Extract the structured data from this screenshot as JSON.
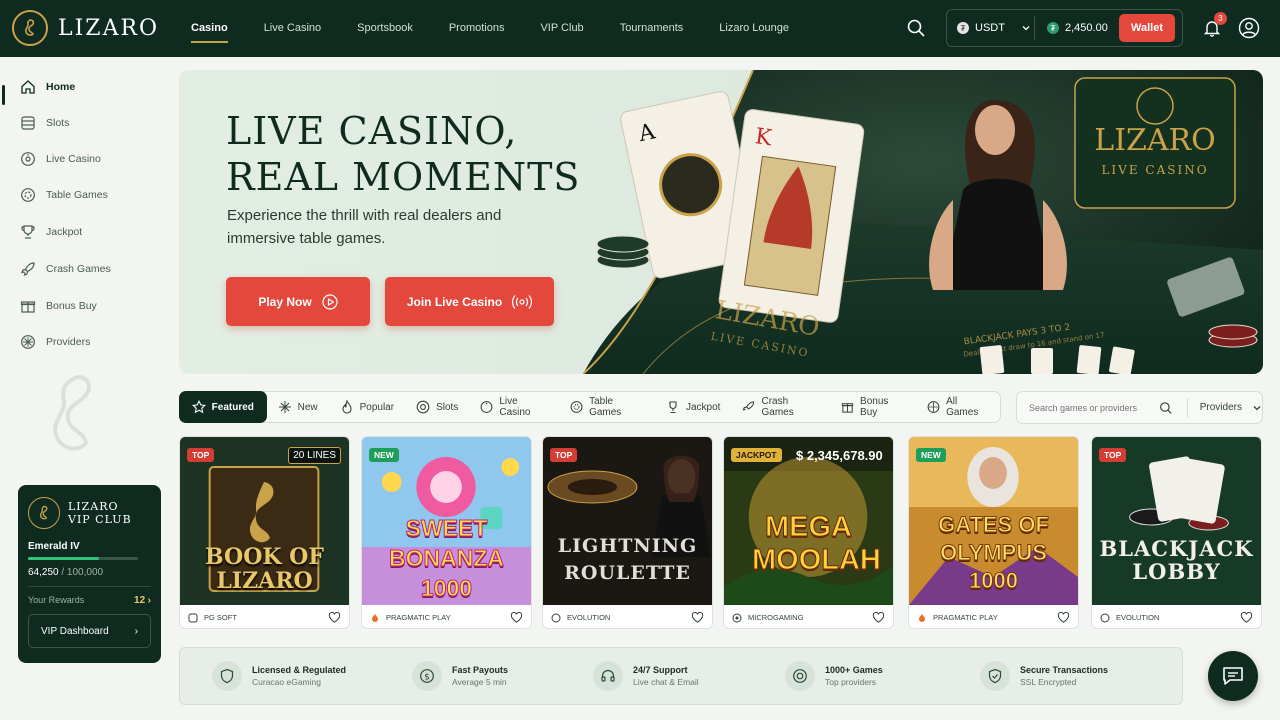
{
  "brand": {
    "name": "LIZARO"
  },
  "nav": {
    "items": [
      "Casino",
      "Live Casino",
      "Sportsbook",
      "Promotions",
      "VIP Club",
      "Tournaments",
      "Lizaro Lounge"
    ],
    "active": "Casino"
  },
  "header": {
    "currency": "USDT",
    "balance": "2,450.00",
    "wallet_label": "Wallet",
    "notification_count": "3",
    "icons": [
      "search-icon",
      "bell-icon",
      "user-icon"
    ]
  },
  "sidebar": {
    "items": [
      {
        "label": "Home",
        "icon": "home-icon",
        "active": true
      },
      {
        "label": "Slots",
        "icon": "slot-machine-icon"
      },
      {
        "label": "Live Casino",
        "icon": "roulette-icon"
      },
      {
        "label": "Table Games",
        "icon": "chip-icon"
      },
      {
        "label": "Jackpot",
        "icon": "trophy-icon"
      },
      {
        "label": "Crash Games",
        "icon": "rocket-icon"
      },
      {
        "label": "Bonus Buy",
        "icon": "gift-icon"
      },
      {
        "label": "Providers",
        "icon": "providers-icon"
      }
    ]
  },
  "vip": {
    "title_line1": "LIZARO",
    "title_line2": "VIP CLUB",
    "level": "Emerald IV",
    "points": "64,250",
    "points_total": "/ 100,000",
    "progress_fraction": 0.6425,
    "rewards_label": "Your Rewards",
    "rewards_count": "12",
    "dashboard_label": "VIP Dashboard"
  },
  "hero": {
    "title_line1": "LIVE CASINO,",
    "title_line2": "REAL MOMENTS",
    "subtitle": "Experience the thrill with real dealers and immersive table games.",
    "play_label": "Play Now",
    "join_label": "Join Live Casino",
    "table_brand": "LIZARO",
    "table_brand_sub": "LIVE CASINO",
    "sign_brand": "LIZARO",
    "sign_sub": "LIVE CASINO",
    "table_text": "BLACKJACK PAYS 3 TO 2",
    "table_text2": "Dealer must draw to 16 and stand on 17"
  },
  "filters": {
    "items": [
      {
        "label": "Featured",
        "icon": "star-icon",
        "active": true
      },
      {
        "label": "New",
        "icon": "sparkle-icon"
      },
      {
        "label": "Popular",
        "icon": "flame-icon"
      },
      {
        "label": "Slots",
        "icon": "slot-icon"
      },
      {
        "label": "Live Casino",
        "icon": "roulette-icon"
      },
      {
        "label": "Table Games",
        "icon": "chip-icon"
      },
      {
        "label": "Jackpot",
        "icon": "trophy-icon"
      },
      {
        "label": "Crash Games",
        "icon": "rocket-icon"
      },
      {
        "label": "Bonus Buy",
        "icon": "gift-icon"
      },
      {
        "label": "All Games",
        "icon": "grid-icon"
      }
    ],
    "search_placeholder": "Search games or providers",
    "providers_label": "Providers"
  },
  "games": [
    {
      "tag": "TOP",
      "tag_type": "top",
      "extra": "20 LINES",
      "title": "BOOK OF LIZARO",
      "provider": "PG SOFT"
    },
    {
      "tag": "NEW",
      "tag_type": "new",
      "title": "SWEET BONANZA 1000",
      "provider": "PRAGMATIC PLAY"
    },
    {
      "tag": "TOP",
      "tag_type": "top",
      "title": "LIGHTNING ROULETTE",
      "provider": "EVOLUTION"
    },
    {
      "tag": "JACKPOT",
      "tag_type": "jackpot",
      "extra": "$ 2,345,678.90",
      "title": "MEGA MOOLAH",
      "provider": "MICROGAMING"
    },
    {
      "tag": "NEW",
      "tag_type": "new",
      "title": "GATES OF OLYMPUS 1000",
      "provider": "PRAGMATIC PLAY"
    },
    {
      "tag": "TOP",
      "tag_type": "top",
      "title": "BLACKJACK LOBBY",
      "provider": "EVOLUTION"
    }
  ],
  "trust": [
    {
      "title": "Licensed & Regulated",
      "sub": "Curacao eGaming",
      "icon": "shield-badge-icon"
    },
    {
      "title": "Fast Payouts",
      "sub": "Average 5 min",
      "icon": "dollar-clock-icon"
    },
    {
      "title": "24/7 Support",
      "sub": "Live chat & Email",
      "icon": "headset-icon"
    },
    {
      "title": "1000+ Games",
      "sub": "Top providers",
      "icon": "chip-icon"
    },
    {
      "title": "Secure Transactions",
      "sub": "SSL Encrypted",
      "icon": "lock-shield-icon"
    }
  ],
  "colors": {
    "brand_dark": "#0f2b1f",
    "accent_red": "#e4473b",
    "gold": "#c9a24a",
    "background": "#f2f5f1"
  }
}
